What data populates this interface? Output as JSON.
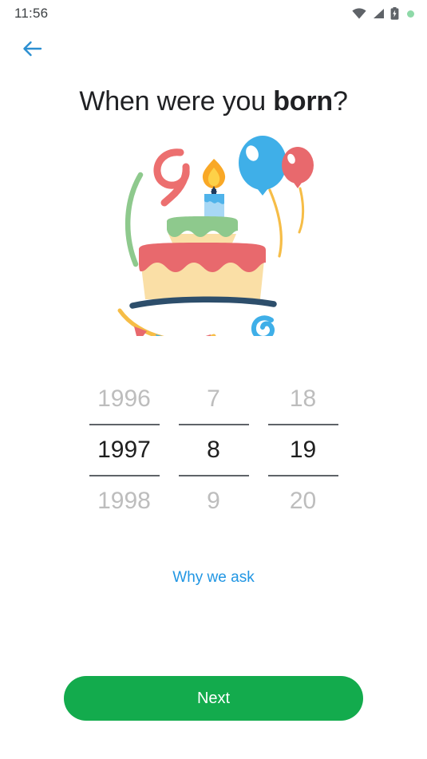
{
  "status_bar": {
    "time": "11:56",
    "icons": [
      "wifi-icon",
      "signal-icon",
      "battery-charging-icon",
      "recording-dot-icon"
    ]
  },
  "nav": {
    "back_icon": "arrow-left-icon"
  },
  "header": {
    "title_prefix": "When were you ",
    "title_emphasis": "born",
    "title_suffix": "?"
  },
  "illustration": {
    "name": "birthday-cake-illustration",
    "elements": [
      "number-nine",
      "green-arc",
      "candle",
      "cake-top-tier",
      "cake-bottom-tier",
      "plate",
      "blue-balloon",
      "red-balloon",
      "bunting",
      "blue-spiral"
    ],
    "colors": {
      "cake_base": "#fadfa6",
      "frosting_red": "#e8696d",
      "frosting_green": "#8ec98d",
      "balloon_blue": "#3fafe8",
      "balloon_red": "#e8696d",
      "string_yellow": "#f6bd47",
      "plate_navy": "#2d4e6b",
      "candle_body": "#a8d8f5",
      "candle_drip": "#4fb3ea",
      "flame_orange": "#f9a826",
      "flame_yellow": "#fdd148",
      "wick_navy": "#1f3a5c",
      "nine_red": "#ec6f6f",
      "arc_green": "#8ec98d"
    }
  },
  "date_picker": {
    "columns": [
      {
        "name": "year",
        "previous": "1996",
        "selected": "1997",
        "next": "1998"
      },
      {
        "name": "month",
        "previous": "7",
        "selected": "8",
        "next": "9"
      },
      {
        "name": "day",
        "previous": "18",
        "selected": "19",
        "next": "20"
      }
    ]
  },
  "why_we_ask": {
    "label": "Why we ask",
    "color": "#2196e3"
  },
  "primary_action": {
    "label": "Next",
    "color": "#13ab4d"
  }
}
